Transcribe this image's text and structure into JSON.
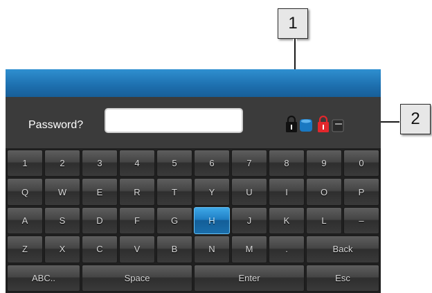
{
  "callouts": [
    "1",
    "2"
  ],
  "dialog": {
    "password_label": "Password?",
    "password_value": ""
  },
  "status_icons": [
    "lock-icon",
    "database-icon",
    "lock-icon",
    "card-icon"
  ],
  "colors": {
    "accent": "#1d6fae",
    "selected_key": "#1f7fc4",
    "alert_lock": "#e3272c"
  },
  "keyboard": {
    "row1": [
      "1",
      "2",
      "3",
      "4",
      "5",
      "6",
      "7",
      "8",
      "9",
      "0"
    ],
    "row2": [
      "Q",
      "W",
      "E",
      "R",
      "T",
      "Y",
      "U",
      "I",
      "O",
      "P"
    ],
    "row3": [
      "A",
      "S",
      "D",
      "F",
      "G",
      "H",
      "J",
      "K",
      "L",
      "–"
    ],
    "row4": [
      "Z",
      "X",
      "C",
      "V",
      "B",
      "N",
      "M",
      "."
    ],
    "back": "Back",
    "abc": "ABC..",
    "space": "Space",
    "enter": "Enter",
    "esc": "Esc",
    "selected_key": "H"
  }
}
